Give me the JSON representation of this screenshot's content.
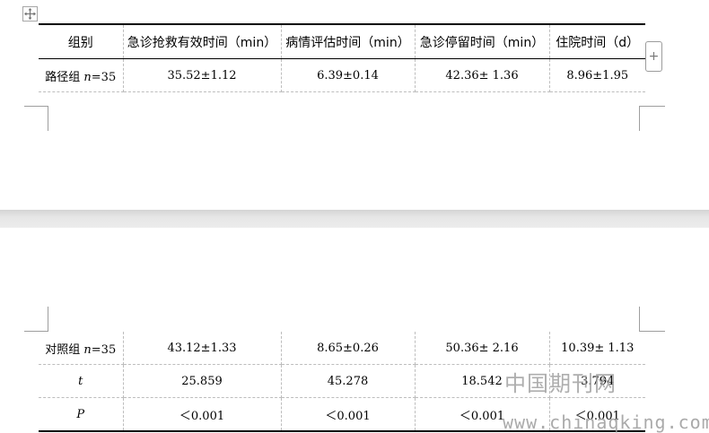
{
  "table": {
    "headers": [
      "组别",
      "急诊抢救有效时间（min）",
      "病情评估时间（min）",
      "急诊停留时间（min）",
      "住院时间（d）"
    ],
    "rows": [
      {
        "group_label": "路径组 ",
        "group_n": "n",
        "group_eq": "=35",
        "cells": [
          "35.52±1.12",
          "6.39±0.14",
          "42.36± 1.36",
          "8.96±1.95"
        ]
      },
      {
        "group_label": "对照组 ",
        "group_n": "n",
        "group_eq": "=35",
        "cells": [
          "43.12±1.33",
          "8.65±0.26",
          "50.36± 2.16",
          "10.39± 1.13"
        ]
      },
      {
        "group_label": "t",
        "cells": [
          "25.859",
          "45.278",
          "18.542",
          "3.794"
        ]
      },
      {
        "group_label": "P",
        "cells": [
          "＜0.001",
          "＜0.001",
          "＜0.001",
          "＜0.001"
        ]
      }
    ]
  },
  "controls": {
    "add_column_label": "+",
    "move_handle_icon": "move-arrows-icon"
  },
  "watermark": {
    "title": "中国期刊网",
    "url": "www.chinaqking.com"
  }
}
